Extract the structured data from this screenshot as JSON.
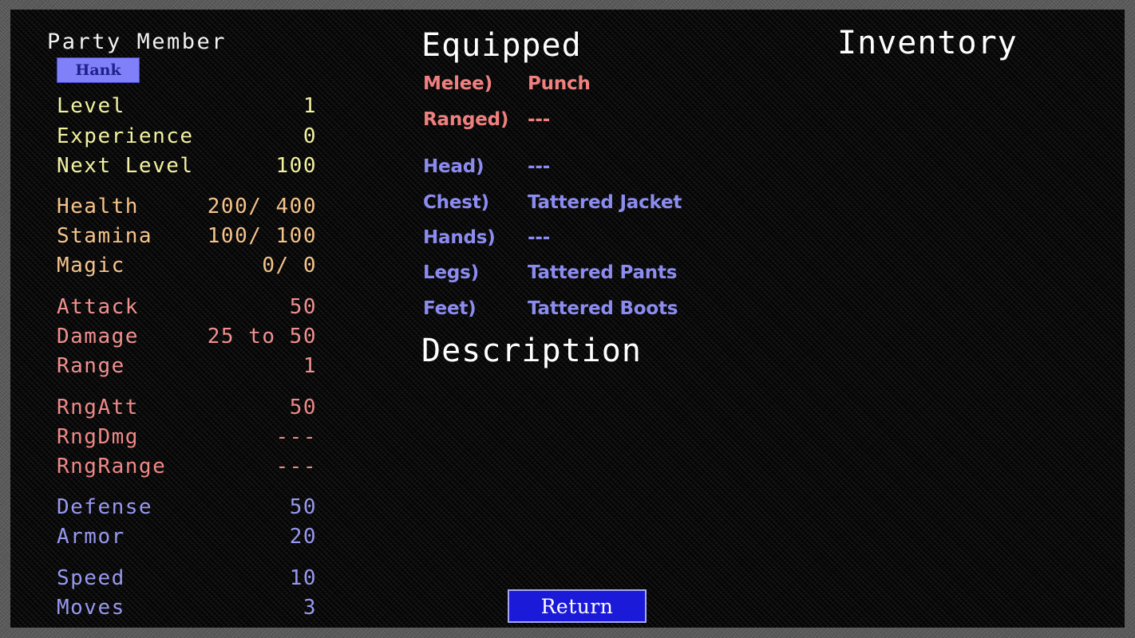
{
  "colors": {
    "header_white": "#ffffff",
    "xp_yellow": "#f2f2a0",
    "vital_orange": "#f5c48c",
    "attack_salmon": "#f09090",
    "defense_periwinkle": "#9898f0",
    "button_face": "#8080f8",
    "button_text": "#20208c",
    "return_face": "#1a1ad8",
    "return_border": "#a8a8f0",
    "field_black": "#0c0b0b",
    "frame_grey": "#5e5e5e"
  },
  "party": {
    "title": "Party Member",
    "selected_member": "Hank",
    "progression": [
      {
        "label": "Level",
        "value": "  1"
      },
      {
        "label": "Experience",
        "value": "  0"
      },
      {
        "label": "Next Level",
        "value": "100"
      }
    ],
    "vitals": [
      {
        "label": "Health",
        "value": "200/ 400"
      },
      {
        "label": "Stamina",
        "value": "100/ 100"
      },
      {
        "label": "Magic",
        "value": "  0/   0"
      }
    ],
    "offense": [
      {
        "label": "Attack",
        "value": "      50"
      },
      {
        "label": "Damage",
        "value": "25 to 50"
      },
      {
        "label": "Range",
        "value": "       1"
      }
    ],
    "ranged": [
      {
        "label": "RngAtt",
        "value": " 50"
      },
      {
        "label": "RngDmg",
        "value": "---"
      },
      {
        "label": "RngRange",
        "value": "---"
      }
    ],
    "defense": [
      {
        "label": "Defense",
        "value": "50"
      },
      {
        "label": "Armor",
        "value": "20"
      }
    ],
    "movement": [
      {
        "label": "Speed",
        "value": "10"
      },
      {
        "label": "Moves",
        "value": " 3"
      }
    ]
  },
  "equipped": {
    "title": "Equipped",
    "weapons": [
      {
        "slot": "Melee)",
        "item": "Punch"
      },
      {
        "slot": "Ranged)",
        "item": "---"
      }
    ],
    "armor": [
      {
        "slot": "Head)",
        "item": "---"
      },
      {
        "slot": "Chest)",
        "item": "Tattered Jacket"
      },
      {
        "slot": "Hands)",
        "item": "---"
      },
      {
        "slot": "Legs)",
        "item": "Tattered Pants"
      },
      {
        "slot": "Feet)",
        "item": "Tattered Boots"
      }
    ]
  },
  "description": {
    "title": "Description",
    "body": ""
  },
  "inventory": {
    "title": "Inventory",
    "items": []
  },
  "actions": {
    "return_label": "Return"
  }
}
